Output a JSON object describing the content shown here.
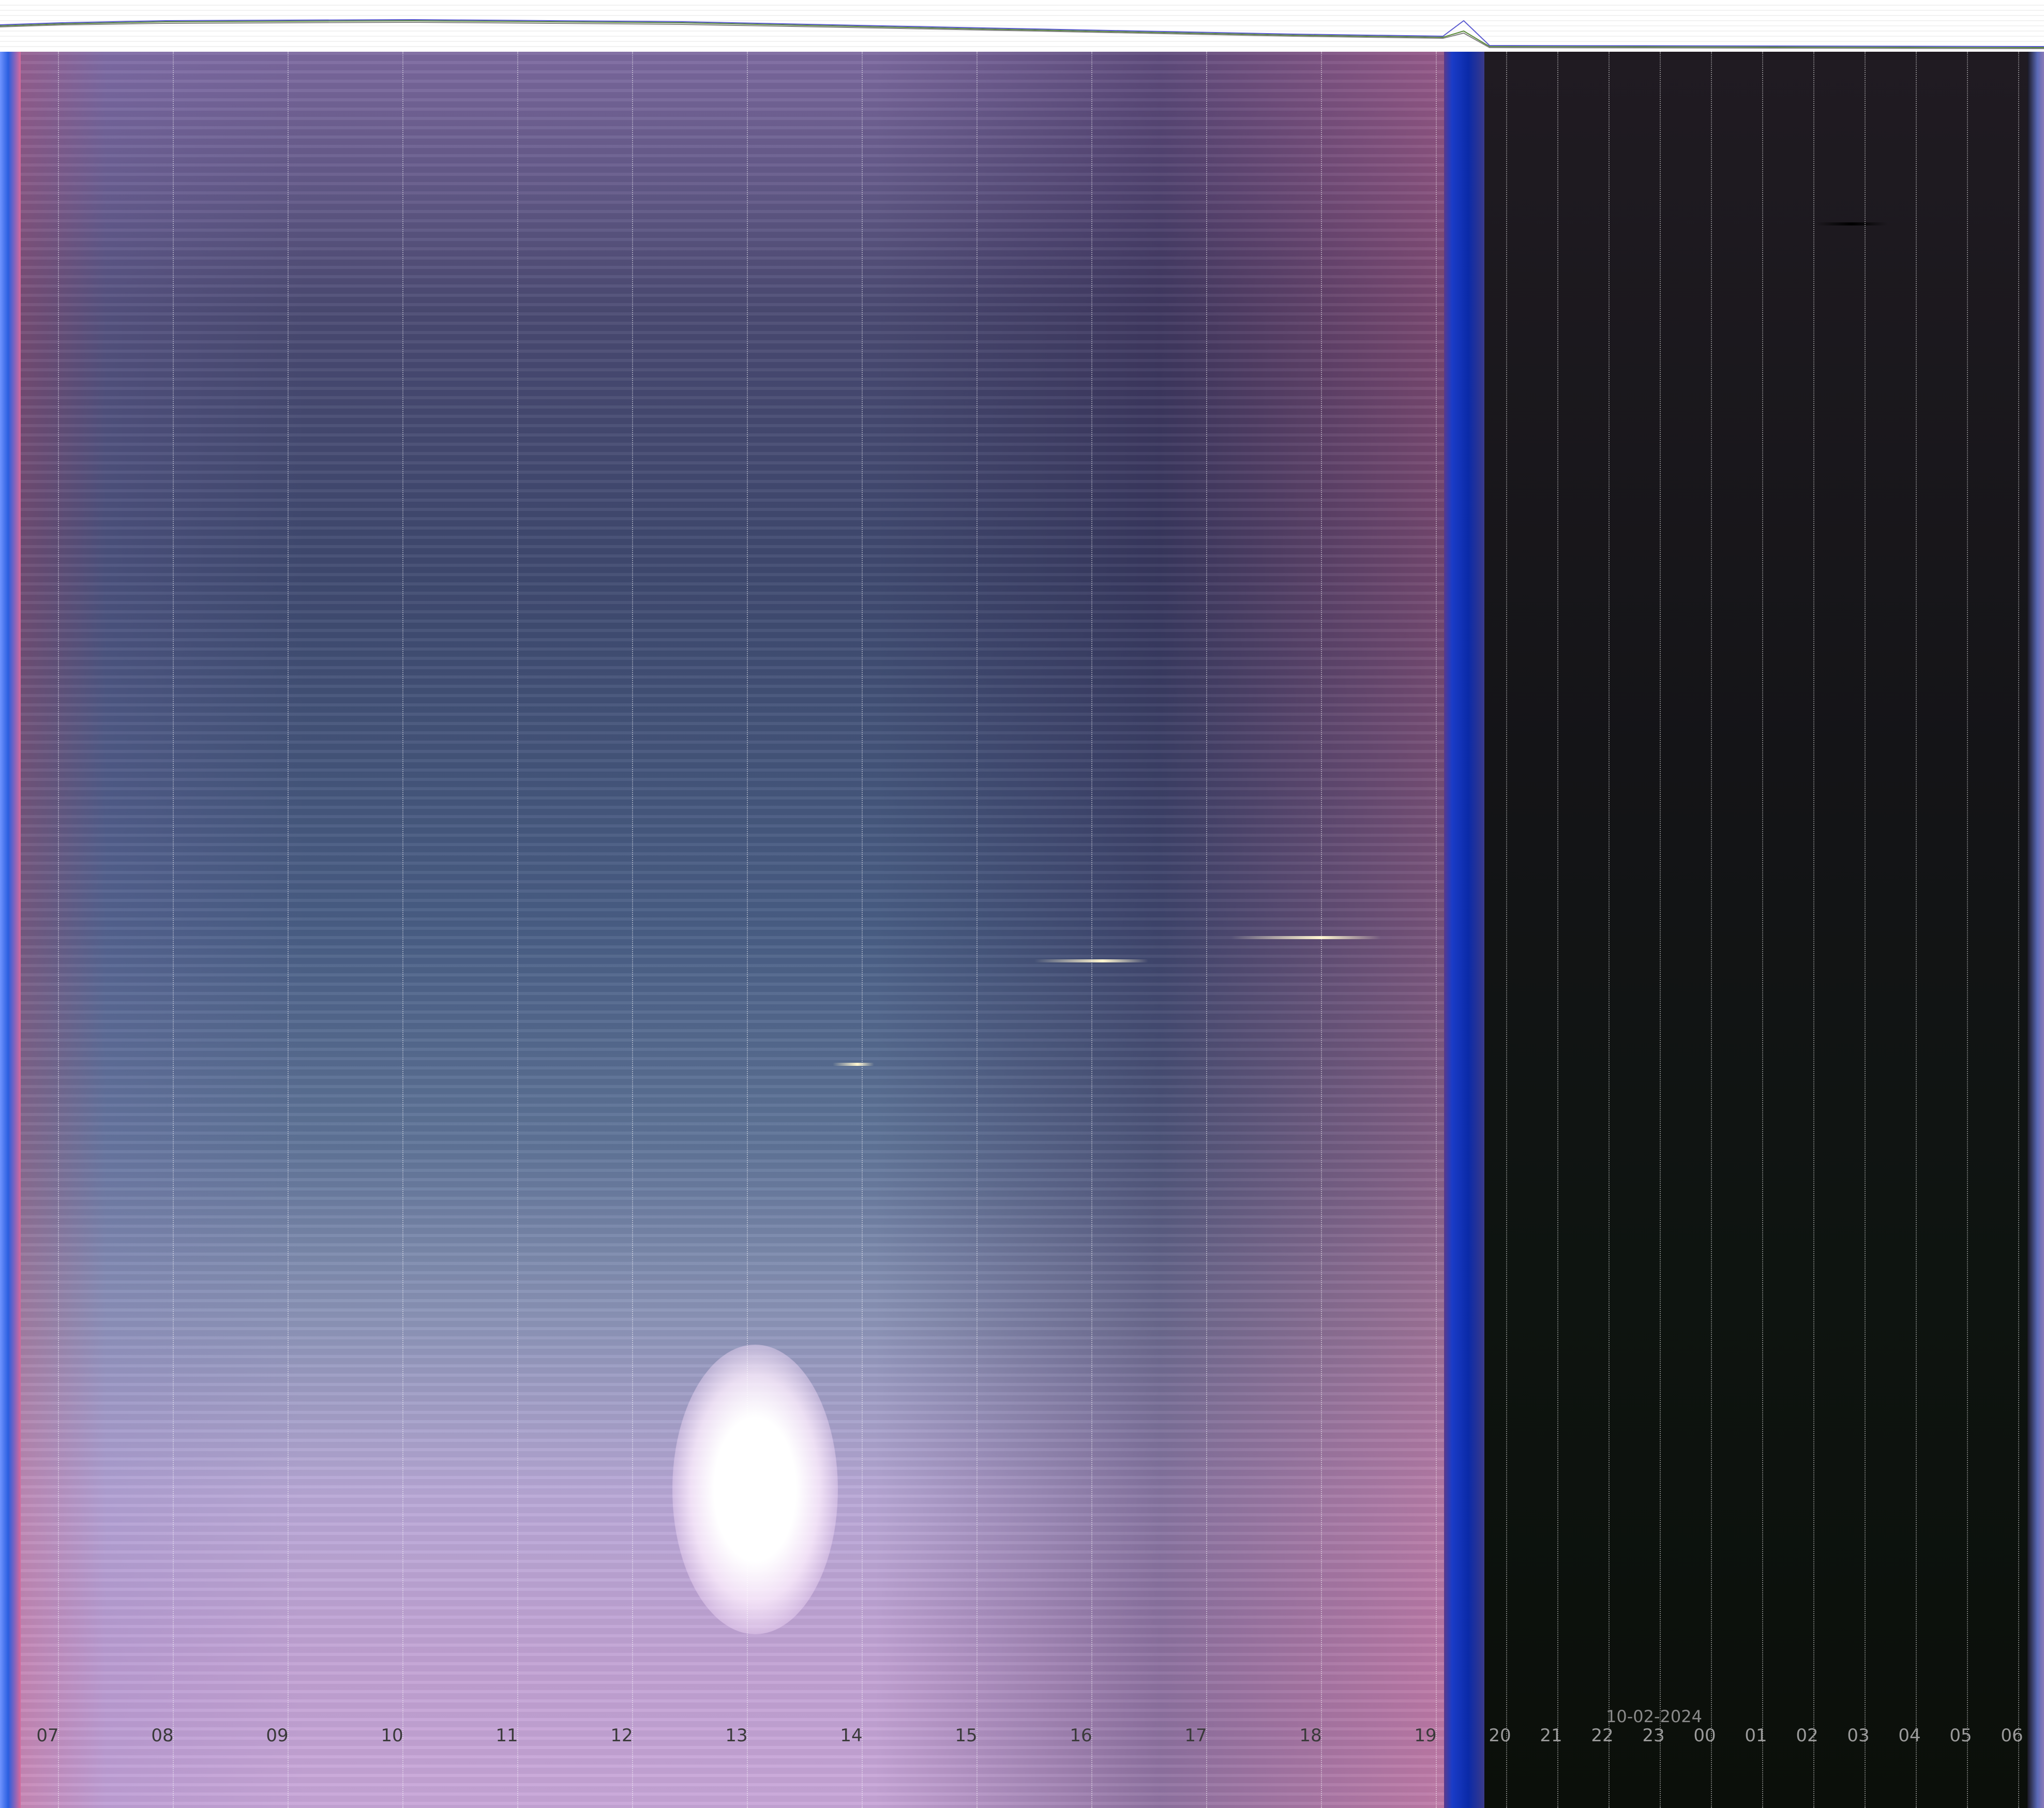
{
  "date_label": "10-02-2024",
  "hour_labels": [
    "07",
    "08",
    "09",
    "10",
    "11",
    "12",
    "13",
    "14",
    "15",
    "16",
    "17",
    "18",
    "19",
    "20",
    "21",
    "22",
    "23",
    "00",
    "01",
    "02",
    "03",
    "04",
    "05",
    "06"
  ],
  "colors": {
    "day_sky": "#4a5f86",
    "twilight_band": "#0a2aa8",
    "night_sky": "#0e1410",
    "sun_glare": "#ffffff"
  }
}
